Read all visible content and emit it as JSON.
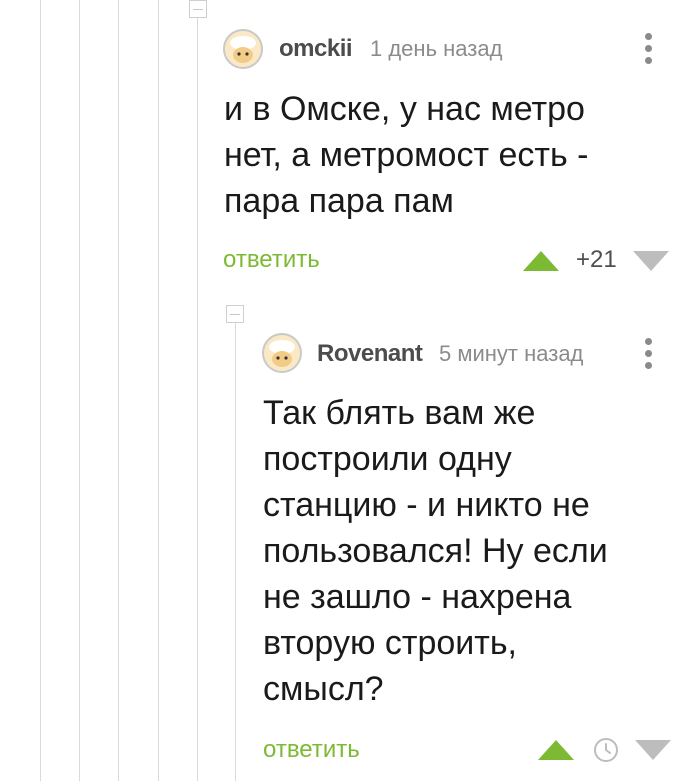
{
  "colors": {
    "accent_green": "#7dba34",
    "thread_line": "#d9d9d9",
    "muted_gray": "#8b8b8b",
    "downvote_gray": "#bdbdbd"
  },
  "comments": [
    {
      "username": "omckii",
      "time": "1 день назад",
      "text": "и в Омске, у нас метро\nнет, а метромост есть -\nпара пара пам",
      "reply_label": "ответить",
      "rating": "+21",
      "icons": [
        "avatar-icon",
        "menu-dots-icon",
        "upvote-icon",
        "downvote-icon"
      ]
    },
    {
      "username": "Rovenant",
      "time": "5 минут назад",
      "text": "Так блять вам же\nпостроили одну\nстанцию - и никто не\nпользовался! Ну если\nне зашло - нахрена\nвторую строить,\nсмысл?",
      "reply_label": "ответить",
      "icons": [
        "avatar-icon",
        "menu-dots-icon",
        "upvote-icon",
        "clock-icon",
        "downvote-icon"
      ]
    }
  ]
}
